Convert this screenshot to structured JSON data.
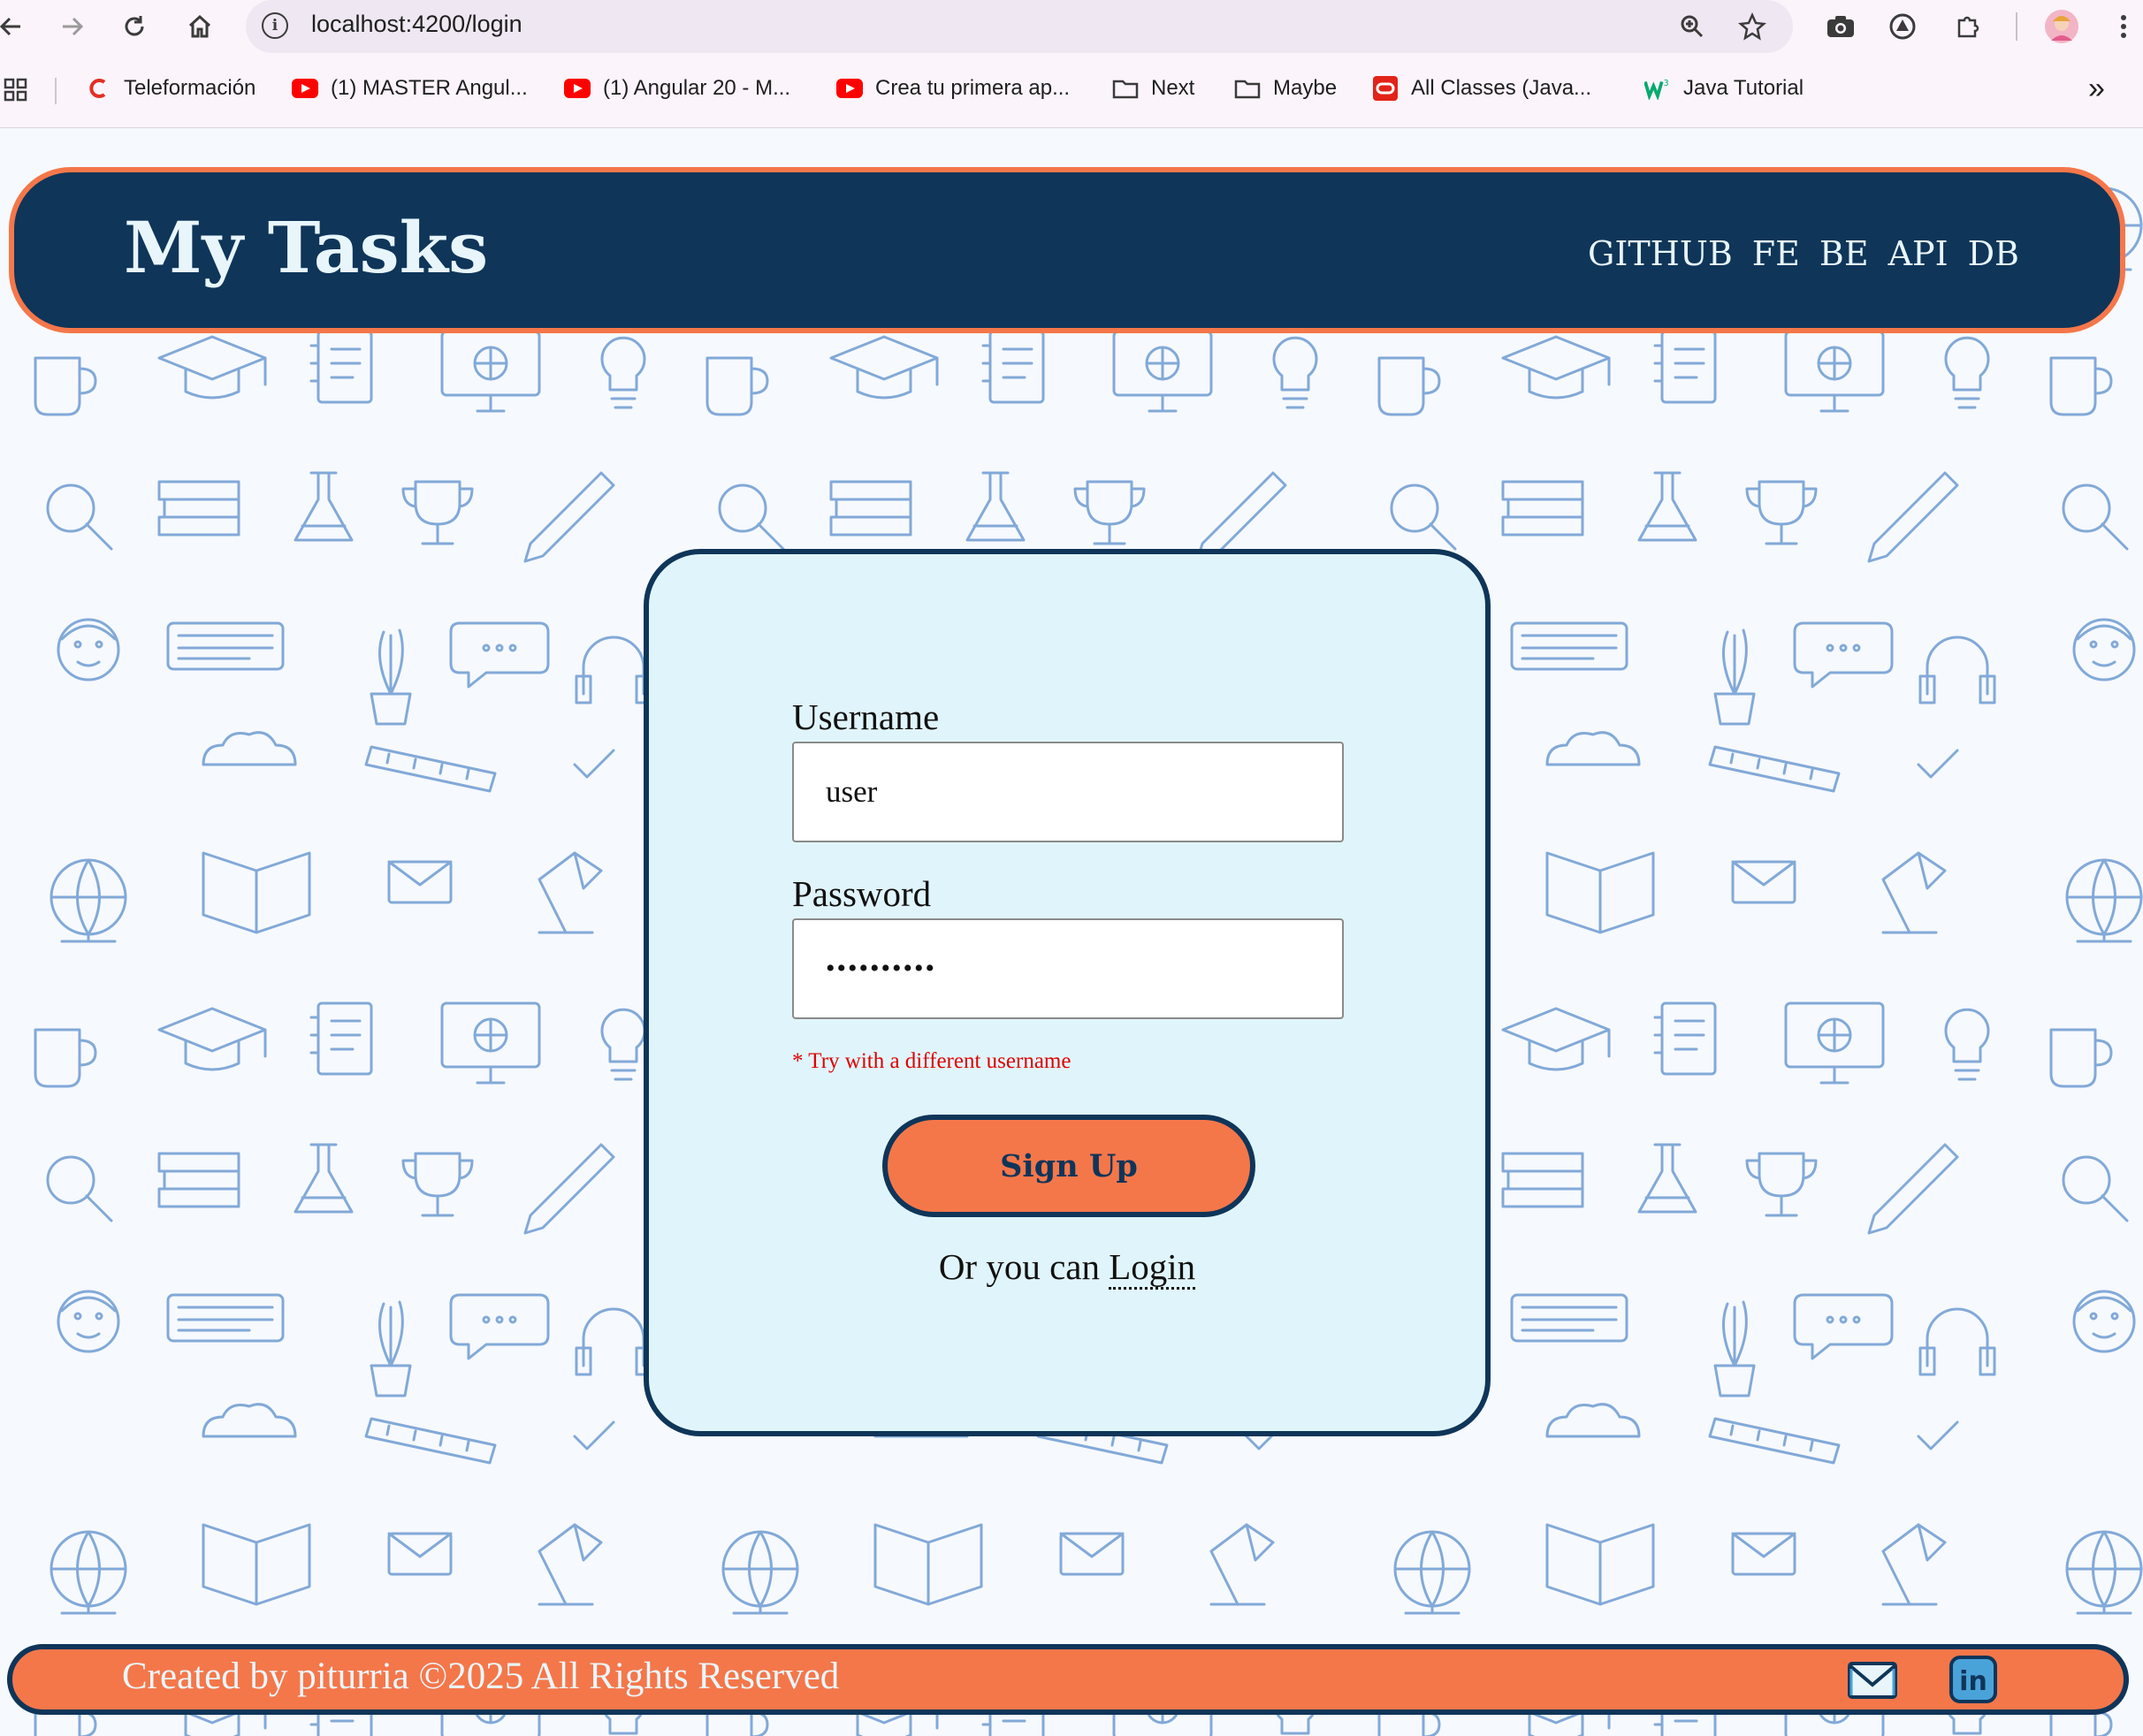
{
  "browser": {
    "url": "localhost:4200/login",
    "info_glyph": "i",
    "bookmarks": [
      {
        "label": "Teleformación",
        "icon": "c-logo-icon"
      },
      {
        "label": "(1) MASTER Angul...",
        "icon": "youtube-icon"
      },
      {
        "label": "(1) Angular 20 - M...",
        "icon": "youtube-icon"
      },
      {
        "label": "Crea tu primera ap...",
        "icon": "youtube-icon"
      },
      {
        "label": "Next",
        "icon": "folder-icon"
      },
      {
        "label": "Maybe",
        "icon": "folder-icon"
      },
      {
        "label": "All Classes (Java...",
        "icon": "oracle-icon"
      },
      {
        "label": "Java Tutorial",
        "icon": "w3schools-icon"
      }
    ],
    "overflow_glyph": "»"
  },
  "header": {
    "brand": "My Tasks",
    "links": [
      "GITHUB",
      "FE",
      "BE",
      "API",
      "DB"
    ]
  },
  "form": {
    "username_label": "Username",
    "username_value": "user",
    "password_label": "Password",
    "password_value": "••••••••••",
    "error": "* Try with a different username",
    "submit_label": "Sign Up",
    "alt_text": "Or you can ",
    "alt_link": "Login"
  },
  "footer": {
    "text": "Created by piturria ©2025 All Rights Reserved",
    "icons": [
      "mail-icon",
      "linkedin-icon"
    ],
    "linkedin_glyph": "in"
  },
  "colors": {
    "navy": "#0f3559",
    "orange": "#f4774a",
    "card_bg": "#e0f5fb",
    "error": "#e00000",
    "pattern": "#6d9bd1"
  }
}
